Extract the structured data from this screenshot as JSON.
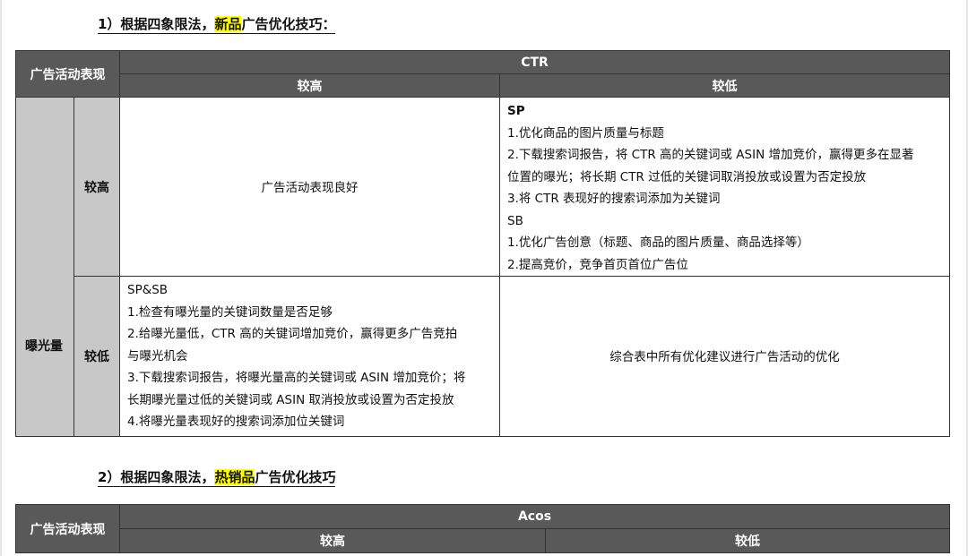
{
  "section1": {
    "heading_prefix": "1）根据四象限法，",
    "heading_highlight": "新品",
    "heading_suffix": "广告优化技巧：",
    "corner_label": "广告活动表现",
    "metric": "CTR",
    "col_high": "较高",
    "col_low": "较低",
    "row_group": "曝光量",
    "row_high": "较高",
    "row_low": "较低",
    "cell_high_high": "广告活动表现良好",
    "cell_high_low": [
      "SP",
      "1.优化商品的图片质量与标题",
      "2.下载搜索词报告，将 CTR 高的关键词或 ASIN 增加竞价，赢得更多在显著",
      "位置的曝光；将长期 CTR 过低的关键词取消投放或设置为否定投放",
      "3.将 CTR 表现好的搜索词添加为关键词",
      "SB",
      "1.优化广告创意（标题、商品的图片质量、商品选择等）",
      "2.提高竞价，竞争首页首位广告位"
    ],
    "cell_low_high": [
      "SP&SB",
      "1.检查有曝光量的关键词数量是否足够",
      "2.给曝光量低，CTR 高的关键词增加竞价，赢得更多广告竞拍",
      "与曝光机会",
      "3.下载搜索词报告，将曝光量高的关键词或 ASIN 增加竞价；将",
      "长期曝光量过低的关键词或 ASIN 取消投放或设置为否定投放",
      "4.将曝光量表现好的搜索词添加位关键词"
    ],
    "cell_low_low": "综合表中所有优化建议进行广告活动的优化"
  },
  "section2": {
    "heading_prefix": "2）根据四象限法，",
    "heading_highlight": "热销品",
    "heading_suffix": "广告优化技巧",
    "corner_label": "广告活动表现",
    "metric": "Acos",
    "col_high": "较高",
    "col_low": "较低"
  },
  "colors": {
    "header_bg": "#595959",
    "side_bg": "#c8c8c8",
    "highlight": "#ffff00"
  }
}
